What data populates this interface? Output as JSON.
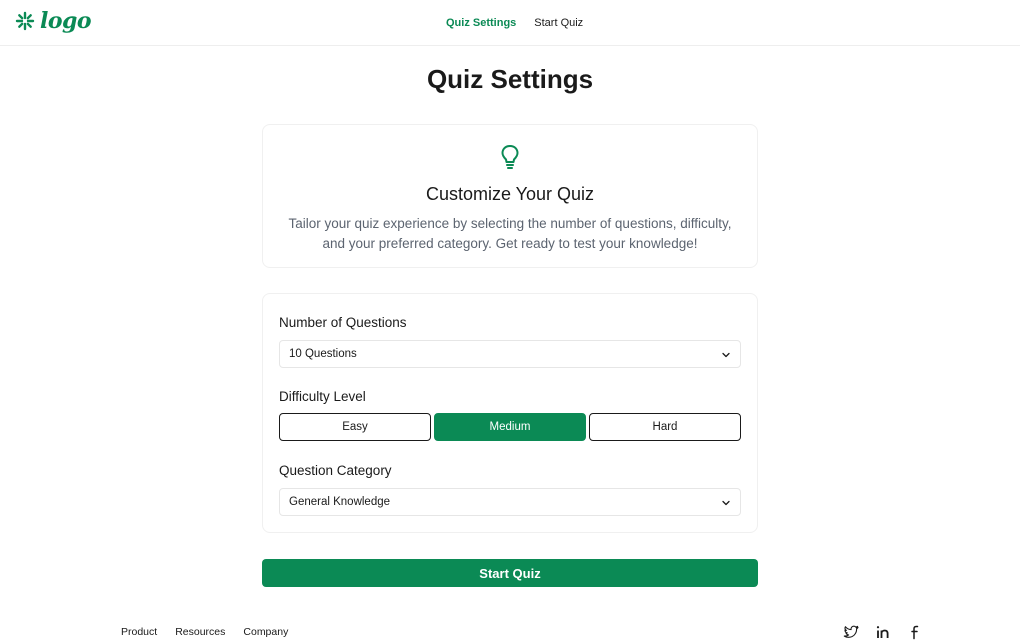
{
  "header": {
    "logo_text": "logo",
    "nav": [
      {
        "label": "Quiz Settings",
        "active": true
      },
      {
        "label": "Start Quiz",
        "active": false
      }
    ]
  },
  "page_title": "Quiz Settings",
  "intro": {
    "icon": "lightbulb-icon",
    "title": "Customize Your Quiz",
    "description": "Tailor your quiz experience by selecting the number of questions, difficulty, and your preferred category. Get ready to test your knowledge!"
  },
  "form": {
    "questions": {
      "label": "Number of Questions",
      "value": "10 Questions"
    },
    "difficulty": {
      "label": "Difficulty Level",
      "options": [
        "Easy",
        "Medium",
        "Hard"
      ],
      "selected": "Medium"
    },
    "category": {
      "label": "Question Category",
      "value": "General Knowledge"
    }
  },
  "start_button": "Start Quiz",
  "footer": {
    "links": [
      "Product",
      "Resources",
      "Company"
    ],
    "social_icons": [
      "twitter-icon",
      "linkedin-icon",
      "facebook-icon"
    ]
  },
  "colors": {
    "accent": "#0b8a55",
    "text": "#1a1a1a",
    "muted": "#5c6470",
    "border": "#eeeeee"
  }
}
